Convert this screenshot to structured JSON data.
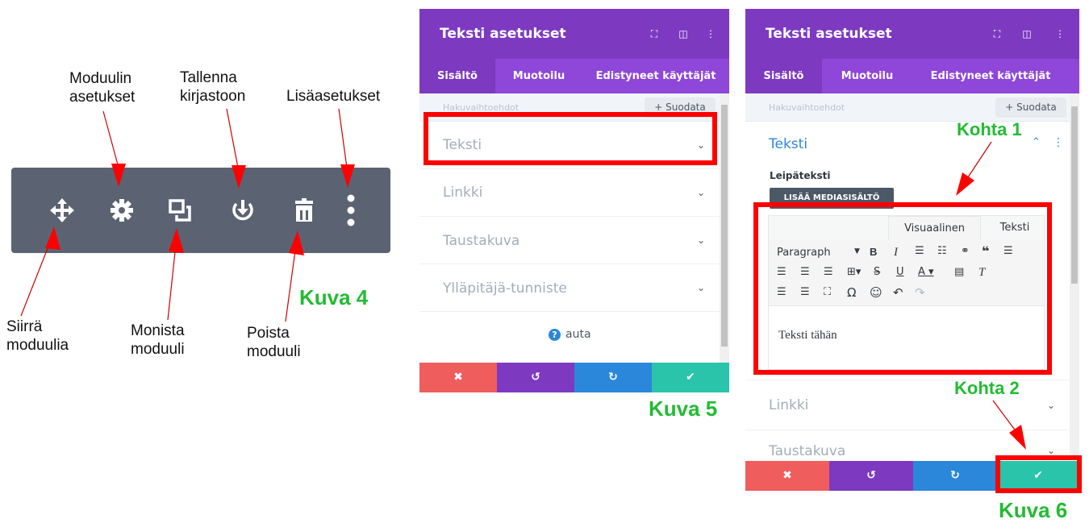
{
  "annotations": {
    "module_settings": "Moduulin\nasetukset",
    "save_to_library": "Tallenna\nkirjastoon",
    "more_settings": "Lisäasetukset",
    "move_module": "Siirrä\nmoduulia",
    "duplicate_module": "Monista\nmoduuli",
    "delete_module": "Poista\nmoduuli"
  },
  "figure_labels": {
    "kuva4": "Kuva 4",
    "kuva5": "Kuva 5",
    "kuva6": "Kuva 6",
    "kohta1": "Kohta 1",
    "kohta2": "Kohta 2"
  },
  "toolbar_icons": [
    "move-icon",
    "gear-icon",
    "duplicate-icon",
    "save-download-icon",
    "trash-icon",
    "more-vertical-icon"
  ],
  "panel": {
    "title": "Teksti asetukset",
    "tabs": [
      "Sisältö",
      "Muotoilu",
      "Edistyneet käyttäjät"
    ],
    "search_placeholder": "Hakuvaihtoehdot",
    "filter_label": "+ Suodata",
    "sections": [
      "Teksti",
      "Linkki",
      "Taustakuva",
      "Ylläpitäjä-tunniste"
    ],
    "help_label": "auta",
    "body_label": "Leipäteksti",
    "add_media": "LISÄÄ MEDIASISÄLTÖ",
    "editor_tabs": [
      "Visuaalinen",
      "Teksti"
    ],
    "paragraph_select": "Paragraph",
    "editor_content": "Teksti tähän"
  },
  "colors": {
    "header": "#7d3ac1",
    "tabs": "#8e47d9",
    "cancel": "#ef5d5d",
    "undo": "#7d3ac1",
    "redo": "#2b87da",
    "save": "#29c4a9",
    "highlight": "#ff0000",
    "label_green": "#22bb33"
  }
}
